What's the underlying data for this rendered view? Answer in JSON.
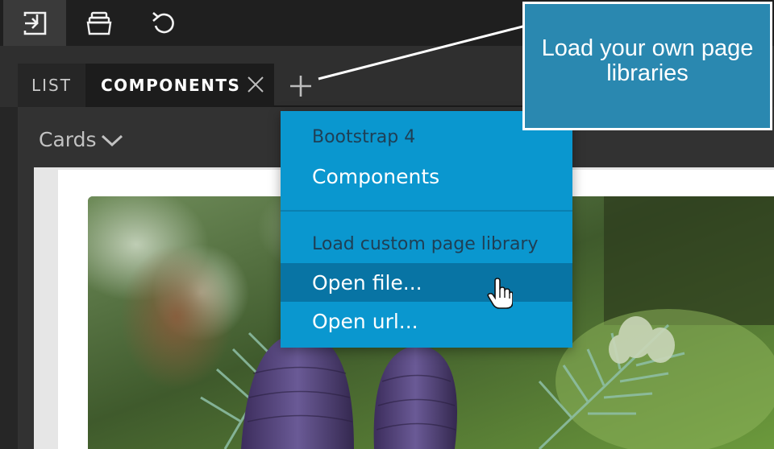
{
  "toolbar": {
    "tools": [
      {
        "icon": "import-icon"
      },
      {
        "icon": "library-icon"
      },
      {
        "icon": "undo-icon"
      }
    ]
  },
  "tabs": {
    "items": [
      {
        "label": "LIST",
        "active": false
      },
      {
        "label": "COMPONENTS",
        "active": true
      }
    ],
    "add_icon": "plus-icon",
    "close_icon": "close-icon"
  },
  "category": {
    "label": "Cards",
    "icon": "chevron-down-icon"
  },
  "menu": {
    "group1_heading": "Bootstrap 4",
    "group1_item": "Components",
    "group2_heading": "Load custom page library",
    "open_file": "Open file...",
    "open_url": "Open url...",
    "highlighted": "Open file..."
  },
  "callout": {
    "text": "Load your own page libraries"
  },
  "colors": {
    "menu_bg": "#0a97cf",
    "menu_highlight": "#0874a4",
    "callout_bg": "#2a88b0",
    "toolbar_bg": "#1f1f1f"
  }
}
